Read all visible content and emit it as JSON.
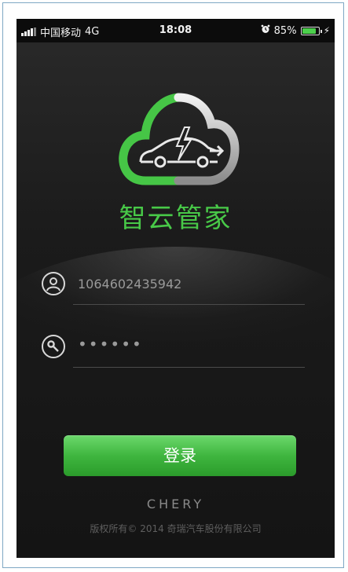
{
  "status_bar": {
    "carrier": "中国移动",
    "network": "4G",
    "time": "18:08",
    "battery_percent": "85%",
    "battery_level": 0.85
  },
  "app": {
    "title": "智云管家",
    "brand_color": "#48c948"
  },
  "login": {
    "account_value": "1064602435942",
    "password_masked": "••••••",
    "submit_label": "登录"
  },
  "footer": {
    "brand": "CHERY",
    "copyright": "版权所有© 2014 奇瑞汽车股份有限公司"
  }
}
